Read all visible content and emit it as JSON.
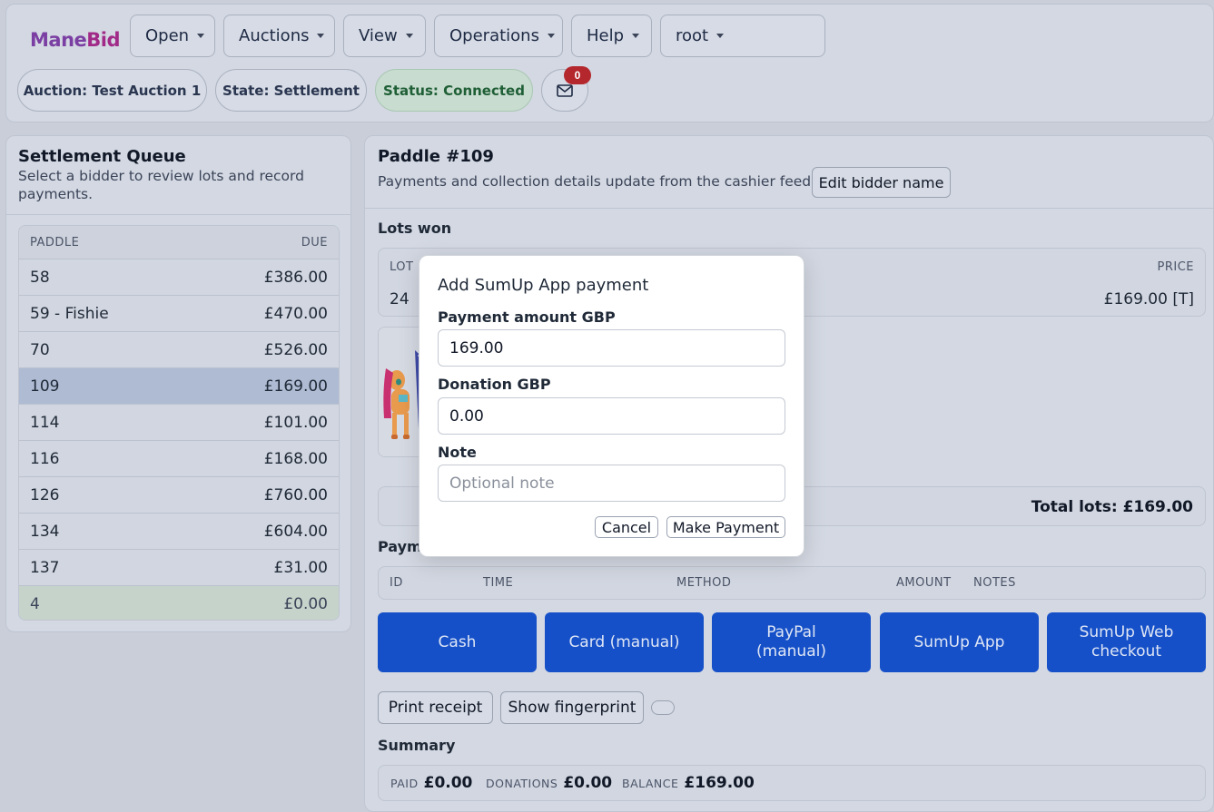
{
  "brand": {
    "part1": "Mane",
    "part2": "Bid"
  },
  "nav": {
    "open": "Open",
    "auctions": "Auctions",
    "view": "View",
    "operations": "Operations",
    "help": "Help",
    "user": "root"
  },
  "status_bar": {
    "auction": "Auction: Test Auction 1",
    "state": "State: Settlement",
    "status": "Status: Connected",
    "mail_count": "0"
  },
  "queue": {
    "title": "Settlement Queue",
    "subtitle": "Select a bidder to review lots and record payments.",
    "col_paddle": "PADDLE",
    "col_due": "DUE",
    "rows": [
      {
        "paddle": "58",
        "due": "£386.00"
      },
      {
        "paddle": "59 - Fishie",
        "due": "£470.00"
      },
      {
        "paddle": "70",
        "due": "£526.00"
      },
      {
        "paddle": "109",
        "due": "£169.00"
      },
      {
        "paddle": "114",
        "due": "£101.00"
      },
      {
        "paddle": "116",
        "due": "£168.00"
      },
      {
        "paddle": "126",
        "due": "£760.00"
      },
      {
        "paddle": "134",
        "due": "£604.00"
      },
      {
        "paddle": "137",
        "due": "£31.00"
      },
      {
        "paddle": "4",
        "due": "£0.00"
      }
    ]
  },
  "bidder": {
    "title": "Paddle #109",
    "subtitle": "Payments and collection details update from the cashier feed.",
    "edit_button": "Edit bidder name",
    "lots_label": "Lots won",
    "lots_col_lot": "LOT",
    "lots_col_price": "PRICE",
    "lot_number": "24",
    "lot_price": "£169.00 [T]",
    "total_lots": "Total lots: £169.00",
    "payments_label": "Payme",
    "pay_cols": {
      "id": "ID",
      "time": "TIME",
      "method": "METHOD",
      "amount": "AMOUNT",
      "notes": "NOTES"
    },
    "methods": {
      "cash": "Cash",
      "card": "Card (manual)",
      "paypal_1": "PayPal",
      "paypal_2": "(manual)",
      "sumup_app": "SumUp App",
      "sumup_web_1": "SumUp Web",
      "sumup_web_2": "checkout"
    },
    "print_receipt": "Print receipt",
    "show_fingerprint": "Show fingerprint",
    "summary_label": "Summary",
    "summary": {
      "paid_k": "PAID",
      "paid_v": "£0.00",
      "donations_k": "DONATIONS",
      "donations_v": "£0.00",
      "balance_k": "BALANCE",
      "balance_v": "£169.00"
    }
  },
  "modal": {
    "title": "Add SumUp App payment",
    "amount_label": "Payment amount GBP",
    "amount_value": "169.00",
    "donation_label": "Donation GBP",
    "donation_value": "0.00",
    "note_label": "Note",
    "note_placeholder": "Optional note",
    "cancel": "Cancel",
    "submit": "Make Payment"
  },
  "colors": {
    "accent": "#1550c8",
    "brand": "#7b3fa3",
    "status_ok": "#1f5f36",
    "badge": "#b3272d"
  }
}
